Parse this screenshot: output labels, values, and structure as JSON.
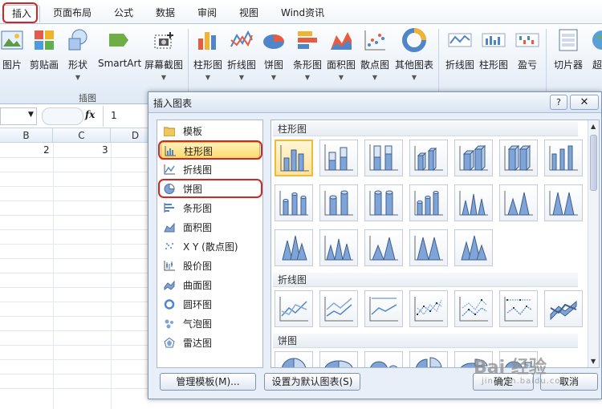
{
  "ribbon_tabs": [
    "插入",
    "页面布局",
    "公式",
    "数据",
    "审阅",
    "视图",
    "Wind资讯"
  ],
  "ribbon_buttons": [
    "图片",
    "剪贴画",
    "形状",
    "SmartArt",
    "屏幕截图",
    "柱形图",
    "折线图",
    "饼图",
    "条形图",
    "面积图",
    "散点图",
    "其他图表",
    "折线图",
    "柱形图",
    "盈亏",
    "切片器",
    "超"
  ],
  "ribbon_group_label": "插图",
  "formula_bar": {
    "fx": "fx",
    "value": "1"
  },
  "grid": {
    "columns": [
      "B",
      "C",
      "D"
    ],
    "cells": [
      "2",
      "3"
    ]
  },
  "dialog": {
    "title": "插入图表",
    "help": "?",
    "close": "✕",
    "categories": [
      "模板",
      "柱形图",
      "折线图",
      "饼图",
      "条形图",
      "面积图",
      "X Y (散点图)",
      "股价图",
      "曲面图",
      "圆环图",
      "气泡图",
      "雷达图"
    ],
    "selected_category": "柱形图",
    "sections": [
      "柱形图",
      "折线图",
      "饼图"
    ],
    "buttons": {
      "manage_templates": "管理模板(M)...",
      "set_default": "设置为默认图表(S)",
      "ok": "确定",
      "cancel": "取消"
    }
  },
  "watermark": {
    "text": "Bai 经验",
    "sub": "jingyan.baidu.com"
  },
  "colors": {
    "highlight_red": "#d42525",
    "selection_gold": "#ffd86a",
    "chart_blue": "#5b83c6"
  }
}
